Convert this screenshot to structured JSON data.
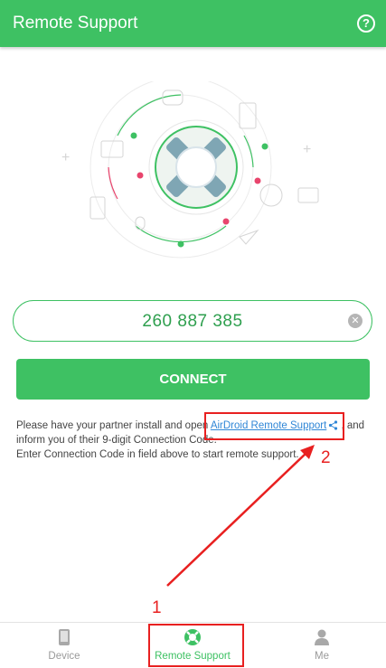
{
  "appbar": {
    "title": "Remote Support",
    "help_icon": "help-circle-icon"
  },
  "connection": {
    "code": "260 887 385",
    "clear_icon": "clear-icon"
  },
  "connect_button": {
    "label": "CONNECT"
  },
  "info": {
    "line1_pre": "Please have your partner install and open ",
    "link": "AirDroid Remote Support",
    "line1_post": " , and",
    "line2": "inform you of their 9-digit Connection Code.",
    "line3": "Enter Connection Code in field above to start remote support."
  },
  "annotations": {
    "num1": "1",
    "num2": "2"
  },
  "nav": [
    {
      "label": "Device",
      "icon": "phone-icon",
      "active": false
    },
    {
      "label": "Remote Support",
      "icon": "lifebuoy-icon",
      "active": true
    },
    {
      "label": "Me",
      "icon": "person-icon",
      "active": false
    }
  ],
  "colors": {
    "primary": "#3ec163",
    "annotation": "#e82020",
    "link": "#2f86d6"
  }
}
